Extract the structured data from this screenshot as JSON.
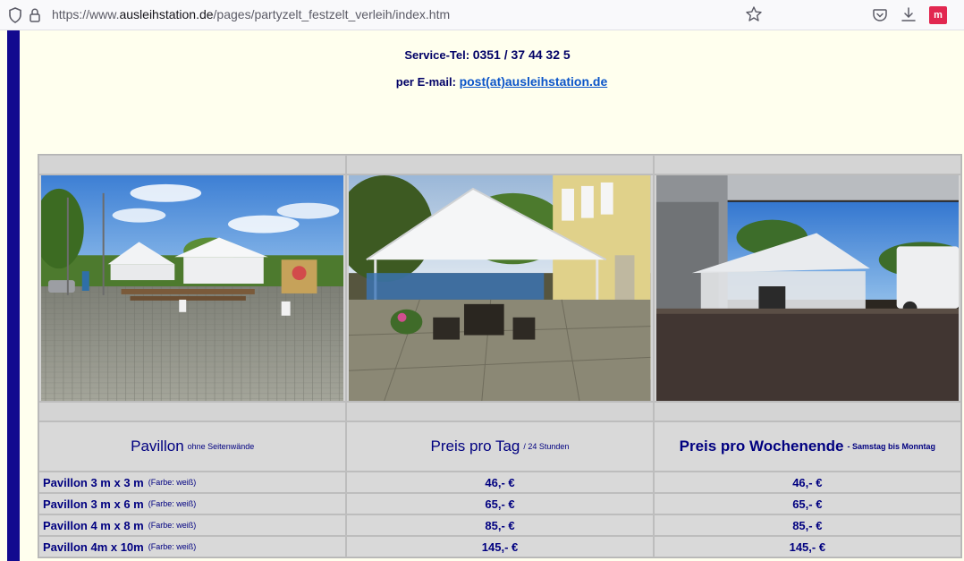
{
  "browser": {
    "url_prefix": "https://www.",
    "url_host": "ausleihstation.de",
    "url_path": "/pages/partyzelt_festzelt_verleih/index.htm",
    "extension_label": "m"
  },
  "contact": {
    "service_label": "Service-Tel:",
    "service_number": "0351 / 37 44 32 5",
    "email_label": "per E-mail:",
    "email_address": "post(at)ausleihstation.de"
  },
  "table": {
    "images": [
      {
        "name": "tent-photo-parking-lot"
      },
      {
        "name": "tent-photo-patio"
      },
      {
        "name": "tent-photo-hall"
      }
    ],
    "headers": [
      {
        "main": "Pavillon",
        "sub": "ohne Seitenwände"
      },
      {
        "main": "Preis pro Tag",
        "sub": "/ 24 Stunden"
      },
      {
        "main": "Preis pro Wochenende",
        "sub": "- Samstag bis Monntag"
      }
    ],
    "rows": [
      {
        "name": "Pavillon 3 m x 3 m",
        "note": "(Farbe: weiß)",
        "day": "46,- €",
        "weekend": "46,- €"
      },
      {
        "name": "Pavillon 3 m x 6 m",
        "note": "(Farbe: weiß)",
        "day": "65,- €",
        "weekend": "65,- €"
      },
      {
        "name": "Pavillon 4 m x 8 m",
        "note": "(Farbe: weiß)",
        "day": "85,- €",
        "weekend": "85,- €"
      },
      {
        "name": "Pavillon 4m x 10m",
        "note": "(Farbe: weiß)",
        "day": "145,- €",
        "weekend": "145,- €"
      }
    ]
  },
  "colors": {
    "page_background": "#ffffee",
    "left_bar": "#120a8f",
    "text_navy": "#000080",
    "link": "#0b55c9",
    "table_gray": "#d9d9d9"
  }
}
